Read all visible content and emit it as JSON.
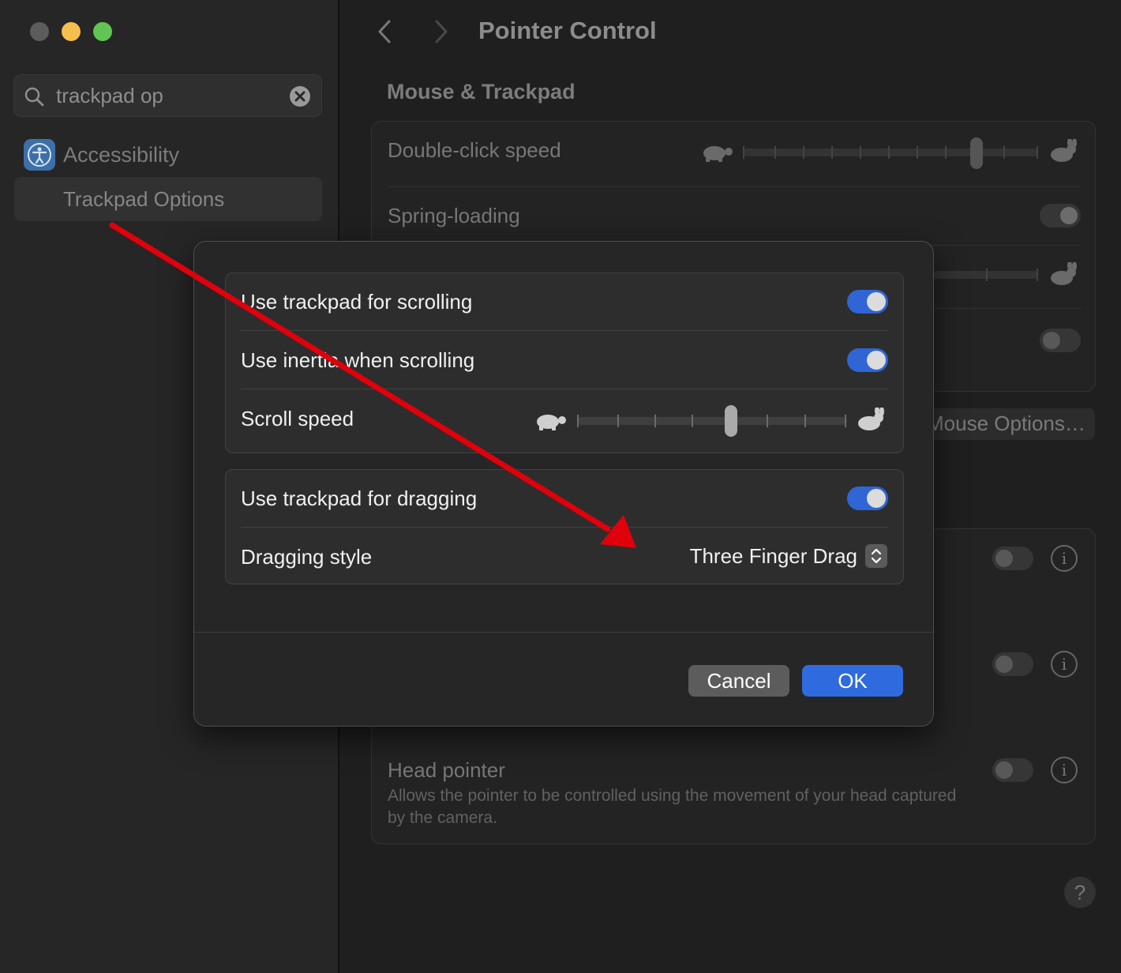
{
  "window": {
    "title": "Pointer Control",
    "traffic_lights": {
      "close": "#5c5c5c",
      "minimize": "#f4bf4f",
      "maximize": "#61c554"
    }
  },
  "sidebar": {
    "search_value": "trackpad op",
    "results": [
      {
        "label": "Accessibility",
        "icon": "accessibility-icon"
      },
      {
        "label": "Trackpad Options",
        "selected": true
      }
    ]
  },
  "main": {
    "section_heading": "Mouse & Trackpad",
    "double_click_speed_label": "Double-click speed",
    "spring_loading_label": "Spring-loading",
    "mouse_options_label": "Mouse Options…",
    "head_pointer": {
      "label": "Head pointer",
      "description": "Allows the pointer to be controlled using the movement of your head captured by the camera."
    },
    "help_label": "?"
  },
  "dialog": {
    "use_scrolling_label": "Use trackpad for scrolling",
    "use_scrolling_on": true,
    "use_inertia_label": "Use inertia when scrolling",
    "use_inertia_on": true,
    "scroll_speed_label": "Scroll speed",
    "scroll_speed_value": 0.57,
    "use_dragging_label": "Use trackpad for dragging",
    "use_dragging_on": true,
    "dragging_style_label": "Dragging style",
    "dragging_style_value": "Three Finger Drag",
    "cancel_label": "Cancel",
    "ok_label": "OK"
  },
  "annotation": {
    "type": "arrow",
    "color": "#e0000b"
  }
}
